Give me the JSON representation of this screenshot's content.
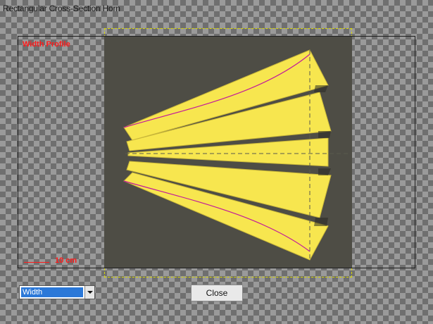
{
  "window": {
    "title": "Rectangular Cross-Section Horn"
  },
  "plot": {
    "label": "Width Profile",
    "scale_label": "10 cm"
  },
  "controls": {
    "view_select_value": "Width",
    "close_label": "Close"
  },
  "colors": {
    "plot_background": "#4e4d45",
    "horn_fill": "#f7e64f",
    "profile_line": "#c21a9b",
    "label_red": "#ff1a1a"
  },
  "icons": {
    "dropdown": "chevron-down-icon"
  }
}
